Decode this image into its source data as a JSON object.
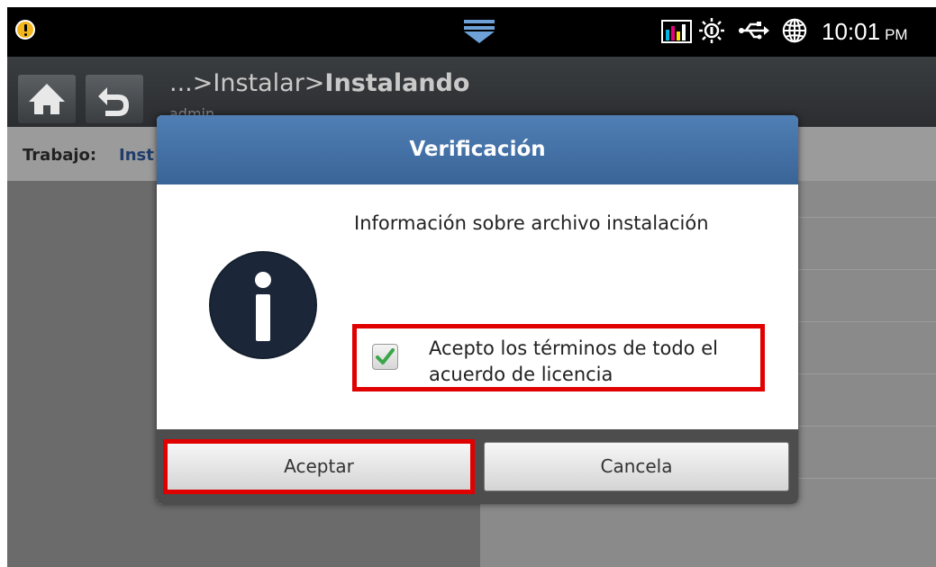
{
  "status_bar": {
    "time": "10:01",
    "ampm": "PM",
    "icons": [
      "warning-icon",
      "notification-pulldown-icon",
      "toner-levels-icon",
      "brightness-icon",
      "usb-icon",
      "network-globe-icon"
    ]
  },
  "header": {
    "breadcrumb_prefix": "...>Instalar>",
    "breadcrumb_current": "Instalando",
    "user": "admin"
  },
  "job": {
    "label": "Trabajo:",
    "value": "Inst"
  },
  "dialog": {
    "title": "Verificación",
    "message": "Información sobre archivo instalación",
    "license_checkbox": {
      "checked": true,
      "label": "Acepto los términos de todo el acuerdo de licencia"
    },
    "accept_label": "Aceptar",
    "cancel_label": "Cancela"
  },
  "colors": {
    "dialog_title_bar": "#3f6ca3",
    "highlight": "#e00000",
    "check_green": "#3aa64a"
  }
}
